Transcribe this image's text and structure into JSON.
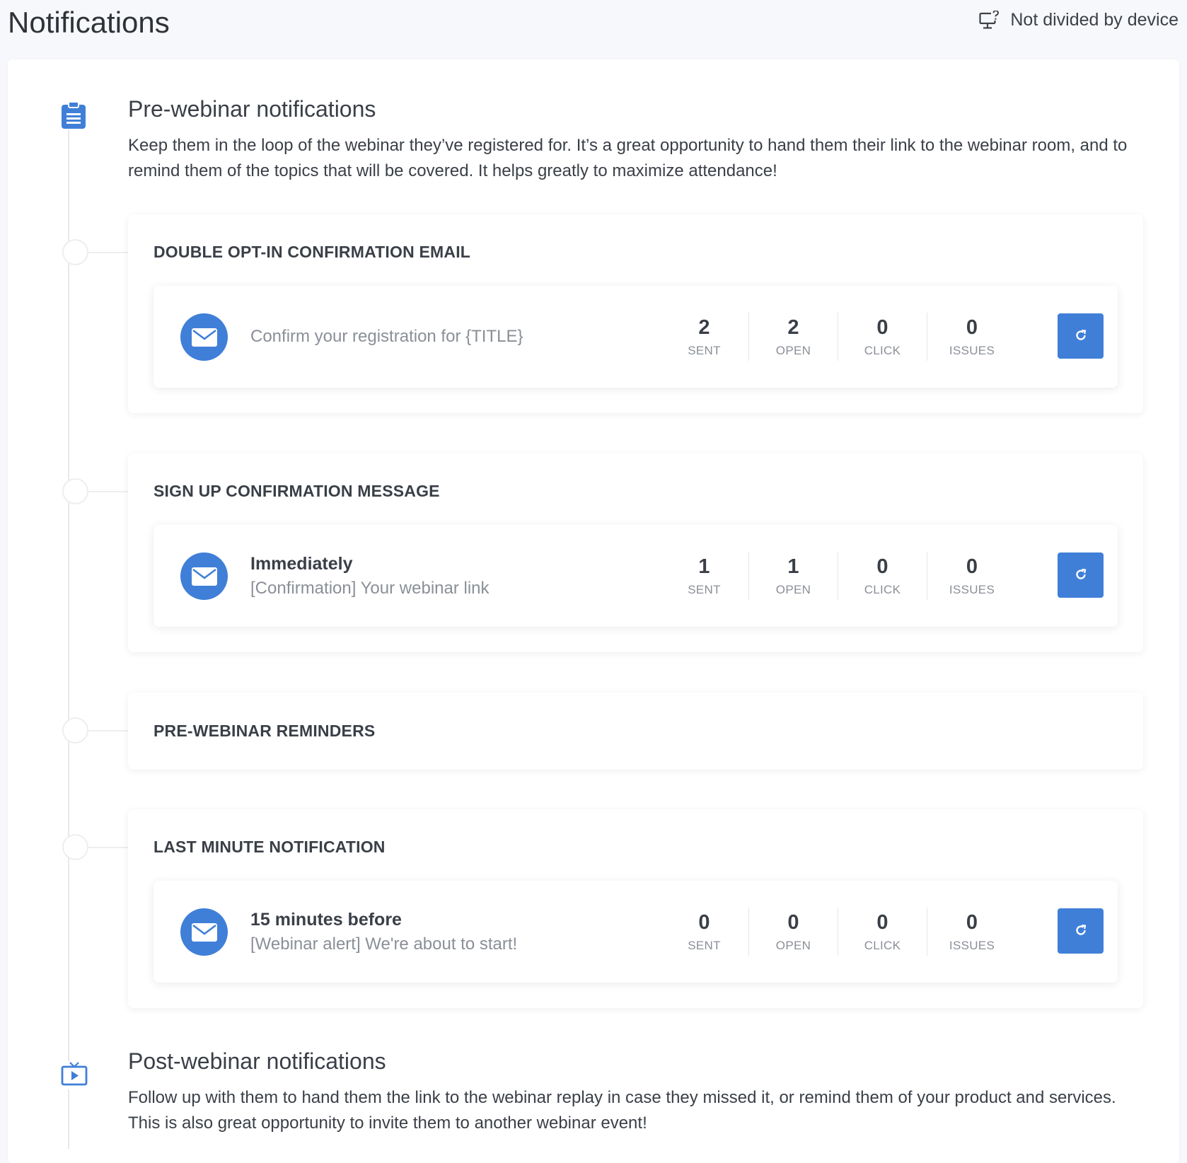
{
  "header": {
    "title": "Notifications",
    "device_toggle_label": "Not divided by device",
    "device_icon": "monitor-question-icon"
  },
  "pre_webinar": {
    "icon": "clipboard-icon",
    "title": "Pre-webinar notifications",
    "description": "Keep them in the loop of the webinar they’ve registered for. It’s a great opportunity to hand them their link to the webinar room, and to remind them of the topics that will be covered. It helps greatly to maximize attendance!",
    "cards": [
      {
        "title": "DOUBLE OPT-IN CONFIRMATION EMAIL",
        "rows": [
          {
            "timing": "",
            "subject": "Confirm your registration for {TITLE}",
            "stats": [
              {
                "value": "2",
                "label": "SENT"
              },
              {
                "value": "2",
                "label": "OPEN"
              },
              {
                "value": "0",
                "label": "CLICK"
              },
              {
                "value": "0",
                "label": "ISSUES"
              }
            ]
          }
        ]
      },
      {
        "title": "SIGN UP CONFIRMATION MESSAGE",
        "rows": [
          {
            "timing": "Immediately",
            "subject": "[Confirmation] Your webinar link",
            "stats": [
              {
                "value": "1",
                "label": "SENT"
              },
              {
                "value": "1",
                "label": "OPEN"
              },
              {
                "value": "0",
                "label": "CLICK"
              },
              {
                "value": "0",
                "label": "ISSUES"
              }
            ]
          }
        ]
      },
      {
        "title": "PRE-WEBINAR REMINDERS",
        "rows": []
      },
      {
        "title": "LAST MINUTE NOTIFICATION",
        "rows": [
          {
            "timing": "15 minutes before",
            "subject": "[Webinar alert] We're about to start!",
            "stats": [
              {
                "value": "0",
                "label": "SENT"
              },
              {
                "value": "0",
                "label": "OPEN"
              },
              {
                "value": "0",
                "label": "CLICK"
              },
              {
                "value": "0",
                "label": "ISSUES"
              }
            ]
          }
        ]
      }
    ]
  },
  "post_webinar": {
    "icon": "tv-play-icon",
    "title": "Post-webinar notifications",
    "description": "Follow up with them to hand them the link to the webinar replay in case they missed it, or remind them of your product and services. This is also great opportunity to invite them to another webinar event!"
  },
  "colors": {
    "accent": "#3f7fd8",
    "background": "#f7f8fb",
    "text": "#3a3f47",
    "muted_text": "#8a8f97"
  }
}
